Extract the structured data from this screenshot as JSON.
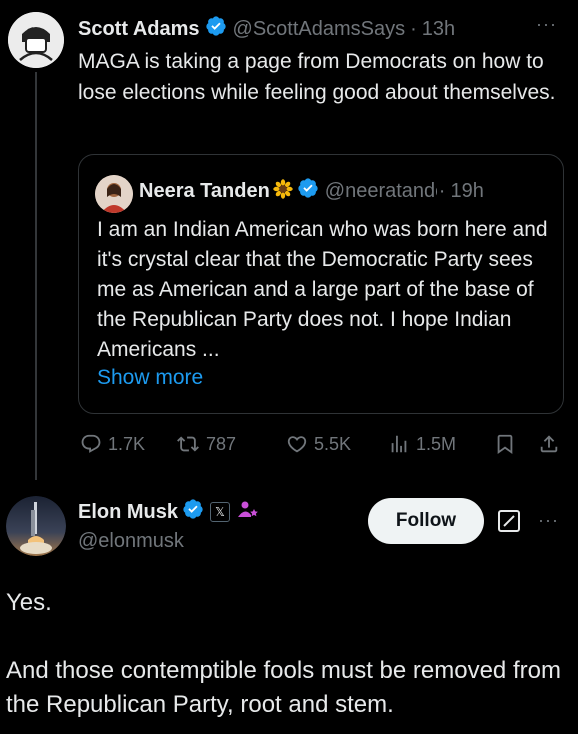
{
  "parent_tweet": {
    "author_name": "Scott Adams",
    "handle": "@ScottAdamsSays",
    "separator": "·",
    "time": "13h",
    "more": "···",
    "text": "MAGA is taking a page from Democrats on how to lose elections while feeling good about themselves.",
    "quote": {
      "author_name": "Neera Tanden",
      "handle": "@neeratanden",
      "separator": "·",
      "time": "19h",
      "text": "I am an Indian American who was born here and it's crystal clear that the Democratic Party sees me as American and a large part of the base of the Republican Party does not. I hope Indian Americans ...",
      "show_more": "Show more"
    },
    "actions": {
      "replies": "1.7K",
      "reposts": "787",
      "likes": "5.5K",
      "views": "1.5M"
    }
  },
  "reply_tweet": {
    "author_name": "Elon Musk",
    "handle": "@elonmusk",
    "x_badge": "𝕏",
    "follow_label": "Follow",
    "more": "···",
    "text_line1": "Yes.",
    "text_line2": "And those contemptible fools must be removed from the Republican Party, root and stem."
  },
  "colors": {
    "background": "#000000",
    "text": "#e7e9ea",
    "muted": "#71767b",
    "verified": "#1d9bf0",
    "link": "#1d9bf0",
    "border": "#2f3336"
  },
  "icons": [
    "verified-badge-icon",
    "sunflower-icon",
    "reply-icon",
    "repost-icon",
    "like-icon",
    "views-icon",
    "bookmark-icon",
    "share-icon",
    "x-logo-icon",
    "subscriber-icon",
    "grok-icon",
    "more-icon"
  ]
}
